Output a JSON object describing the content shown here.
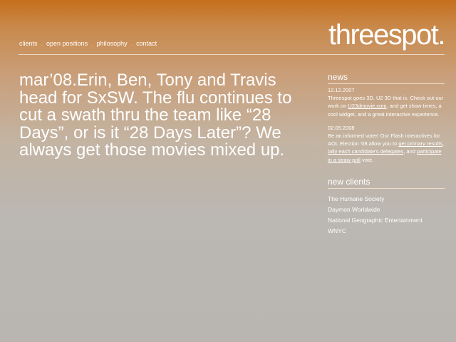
{
  "nav": {
    "items": [
      "clients",
      "open positions",
      "philosophy",
      "contact"
    ],
    "separator": "."
  },
  "logo": {
    "text": "threespot."
  },
  "headline": {
    "text": "mar’08.Erin, Ben, Tony and Travis head for SxSW. The flu continues to cut a swath thru the team like “28 Days”, or is it “28 Days Later”? We always get those movies mixed up."
  },
  "news": {
    "heading": "news",
    "items": [
      {
        "date": "12.12.2007",
        "text1": "Threespot goes 3D. U2 3D that is. Check out our work on ",
        "link1": "U23dmovie.com",
        "text2": ", and get show times, a cool widget, and a great interactive experience."
      },
      {
        "date": "02.05.2008",
        "text1": "Be an informed voter! Our Flash interactives for AOL Election ’08 allow you to ",
        "link1": "get primary results",
        "text2": ", ",
        "link2": "tally each candidate’s delegates",
        "text3": ", and ",
        "link3": "participate in a straw poll",
        "text4": " vote."
      }
    ]
  },
  "new_clients": {
    "heading": "new clients",
    "items": [
      "The Humane Society",
      "Daymon Worldwide",
      "National Geographic Entertainment",
      "WNYC"
    ]
  },
  "colors": {
    "top": "#c66f1c",
    "bottom": "#b9b6b1",
    "text": "#ffffff"
  }
}
